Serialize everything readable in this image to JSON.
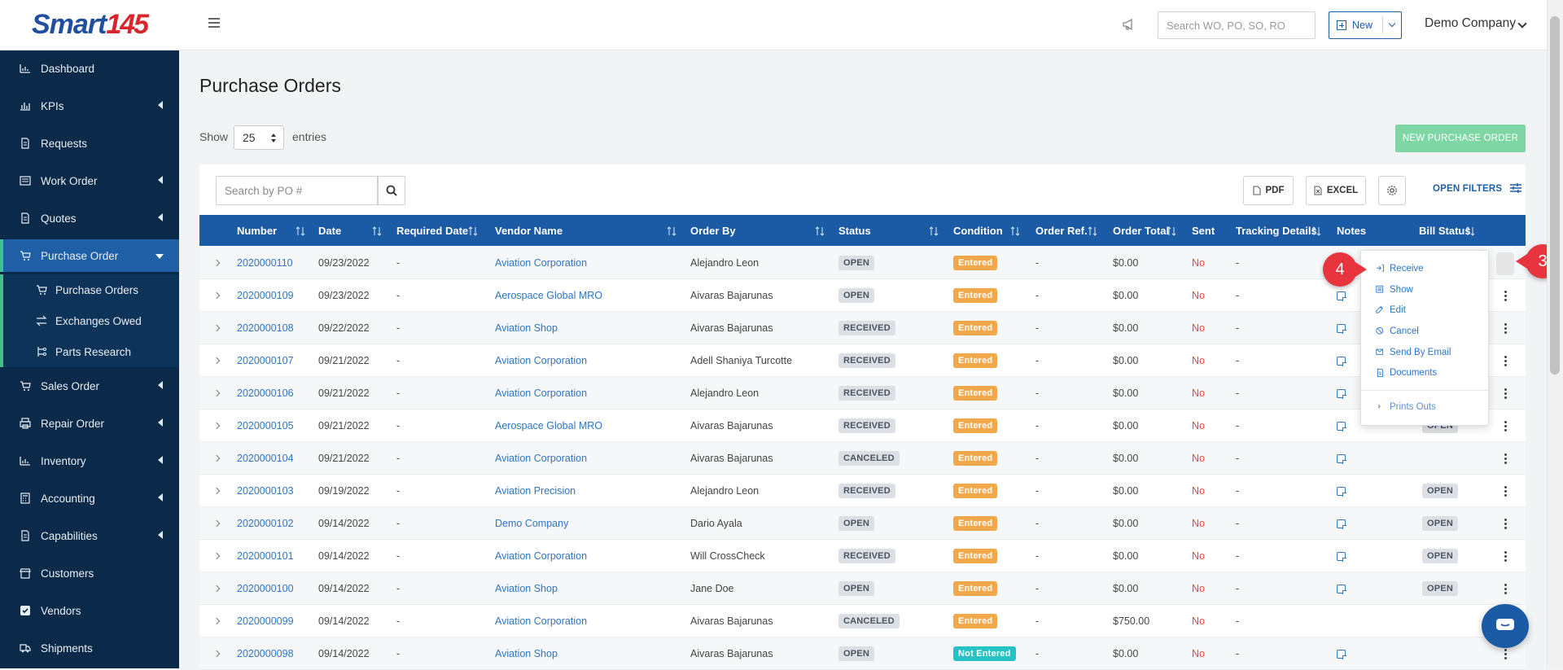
{
  "app": {
    "logo_text_1": "Smart",
    "logo_text_2": "145"
  },
  "sidebar": {
    "items": [
      {
        "label": "Dashboard",
        "icon": "chart-icon"
      },
      {
        "label": "KPIs",
        "icon": "bar-chart-icon"
      },
      {
        "label": "Requests",
        "icon": "document-icon"
      },
      {
        "label": "Work Order",
        "icon": "list-icon"
      },
      {
        "label": "Quotes",
        "icon": "document-icon"
      },
      {
        "label": "Purchase Order",
        "icon": "cart-icon"
      },
      {
        "label": "Sales Order",
        "icon": "cart-icon"
      },
      {
        "label": "Repair Order",
        "icon": "printer-icon"
      },
      {
        "label": "Inventory",
        "icon": "chart-icon"
      },
      {
        "label": "Accounting",
        "icon": "calculator-icon"
      },
      {
        "label": "Capabilities",
        "icon": "document-icon"
      },
      {
        "label": "Customers",
        "icon": "store-icon"
      },
      {
        "label": "Vendors",
        "icon": "check-icon"
      },
      {
        "label": "Shipments",
        "icon": "truck-icon"
      }
    ],
    "sub_items": [
      {
        "label": "Purchase Orders",
        "icon": "cart-icon"
      },
      {
        "label": "Exchanges Owed",
        "icon": "exchange-icon"
      },
      {
        "label": "Parts Research",
        "icon": "tree-icon"
      }
    ]
  },
  "topbar": {
    "search_placeholder": "Search WO, PO, SO, RO",
    "new_label": "New",
    "company": "Demo Company"
  },
  "page": {
    "title": "Purchase Orders",
    "show_label": "Show",
    "entries_value": "25",
    "entries_label": "entries",
    "new_po_label": "NEW PURCHASE ORDER",
    "po_search_placeholder": "Search by PO #",
    "pdf_label": "PDF",
    "excel_label": "EXCEL",
    "open_filters_label": "OPEN FILTERS"
  },
  "table": {
    "columns": [
      "Number",
      "Date",
      "Required Date",
      "Vendor Name",
      "Order By",
      "Status",
      "Condition",
      "Order Ref.",
      "Order Total",
      "Sent",
      "Tracking Details",
      "Notes",
      "Bill Status"
    ],
    "rows": [
      {
        "number": "2020000110",
        "date": "09/23/2022",
        "required": "-",
        "vendor": "Aviation Corporation",
        "order_by": "Alejandro Leon",
        "status": "OPEN",
        "condition": "Entered",
        "ref": "-",
        "total": "$0.00",
        "sent": "No",
        "tracking": "-",
        "note": false,
        "bill": ""
      },
      {
        "number": "2020000109",
        "date": "09/23/2022",
        "required": "-",
        "vendor": "Aerospace Global MRO",
        "order_by": "Aivaras Bajarunas",
        "status": "OPEN",
        "condition": "Entered",
        "ref": "-",
        "total": "$0.00",
        "sent": "No",
        "tracking": "-",
        "note": true,
        "bill": ""
      },
      {
        "number": "2020000108",
        "date": "09/22/2022",
        "required": "-",
        "vendor": "Aviation Shop",
        "order_by": "Aivaras Bajarunas",
        "status": "RECEIVED",
        "condition": "Entered",
        "ref": "-",
        "total": "$0.00",
        "sent": "No",
        "tracking": "-",
        "note": true,
        "bill": ""
      },
      {
        "number": "2020000107",
        "date": "09/21/2022",
        "required": "-",
        "vendor": "Aviation Corporation",
        "order_by": "Adell Shaniya Turcotte",
        "status": "RECEIVED",
        "condition": "Entered",
        "ref": "-",
        "total": "$0.00",
        "sent": "No",
        "tracking": "-",
        "note": true,
        "bill": ""
      },
      {
        "number": "2020000106",
        "date": "09/21/2022",
        "required": "-",
        "vendor": "Aviation Corporation",
        "order_by": "Alejandro Leon",
        "status": "RECEIVED",
        "condition": "Entered",
        "ref": "-",
        "total": "$0.00",
        "sent": "No",
        "tracking": "-",
        "note": true,
        "bill": ""
      },
      {
        "number": "2020000105",
        "date": "09/21/2022",
        "required": "-",
        "vendor": "Aerospace Global MRO",
        "order_by": "Aivaras Bajarunas",
        "status": "RECEIVED",
        "condition": "Entered",
        "ref": "-",
        "total": "$0.00",
        "sent": "No",
        "tracking": "-",
        "note": true,
        "bill": "OPEN"
      },
      {
        "number": "2020000104",
        "date": "09/21/2022",
        "required": "-",
        "vendor": "Aviation Corporation",
        "order_by": "Aivaras Bajarunas",
        "status": "CANCELED",
        "condition": "Entered",
        "ref": "-",
        "total": "$0.00",
        "sent": "No",
        "tracking": "-",
        "note": true,
        "bill": ""
      },
      {
        "number": "2020000103",
        "date": "09/19/2022",
        "required": "-",
        "vendor": "Aviation Precision",
        "order_by": "Alejandro Leon",
        "status": "RECEIVED",
        "condition": "Entered",
        "ref": "-",
        "total": "$0.00",
        "sent": "No",
        "tracking": "-",
        "note": true,
        "bill": "OPEN"
      },
      {
        "number": "2020000102",
        "date": "09/14/2022",
        "required": "-",
        "vendor": "Demo Company",
        "order_by": "Dario Ayala",
        "status": "OPEN",
        "condition": "Entered",
        "ref": "-",
        "total": "$0.00",
        "sent": "No",
        "tracking": "-",
        "note": true,
        "bill": "OPEN"
      },
      {
        "number": "2020000101",
        "date": "09/14/2022",
        "required": "-",
        "vendor": "Aviation Corporation",
        "order_by": "Will CrossCheck",
        "status": "RECEIVED",
        "condition": "Entered",
        "ref": "-",
        "total": "$0.00",
        "sent": "No",
        "tracking": "-",
        "note": true,
        "bill": "OPEN"
      },
      {
        "number": "2020000100",
        "date": "09/14/2022",
        "required": "-",
        "vendor": "Aviation Shop",
        "order_by": "Jane Doe",
        "status": "OPEN",
        "condition": "Entered",
        "ref": "-",
        "total": "$0.00",
        "sent": "No",
        "tracking": "-",
        "note": true,
        "bill": "OPEN"
      },
      {
        "number": "2020000099",
        "date": "09/14/2022",
        "required": "-",
        "vendor": "Aviation Corporation",
        "order_by": "Aivaras Bajarunas",
        "status": "CANCELED",
        "condition": "Entered",
        "ref": "-",
        "total": "$750.00",
        "sent": "No",
        "tracking": "-",
        "note": false,
        "bill": ""
      },
      {
        "number": "2020000098",
        "date": "09/14/2022",
        "required": "-",
        "vendor": "Aviation Shop",
        "order_by": "Aivaras Bajarunas",
        "status": "OPEN",
        "condition": "Not Entered",
        "ref": "-",
        "total": "$0.00",
        "sent": "No",
        "tracking": "-",
        "note": true,
        "bill": ""
      }
    ]
  },
  "dropdown": {
    "items": [
      {
        "label": "Receive",
        "icon": "receive-icon"
      },
      {
        "label": "Show",
        "icon": "show-icon"
      },
      {
        "label": "Edit",
        "icon": "edit-icon"
      },
      {
        "label": "Cancel",
        "icon": "cancel-icon"
      },
      {
        "label": "Send By Email",
        "icon": "email-icon"
      },
      {
        "label": "Documents",
        "icon": "document-icon"
      },
      {
        "label": "Prints Outs",
        "icon": "caret-right-icon"
      }
    ]
  },
  "callouts": {
    "step_a": "3",
    "step_b": "4"
  },
  "colors": {
    "sidebar": "#0b2a4a",
    "active_nav": "#1e5fa6",
    "accent_green": "#40c08a",
    "header_blue": "#1b5aa4",
    "link": "#2d75c5",
    "condition_orange": "#f0a84a",
    "not_entered_teal": "#26c3c6",
    "callout_red": "#e8343f"
  }
}
